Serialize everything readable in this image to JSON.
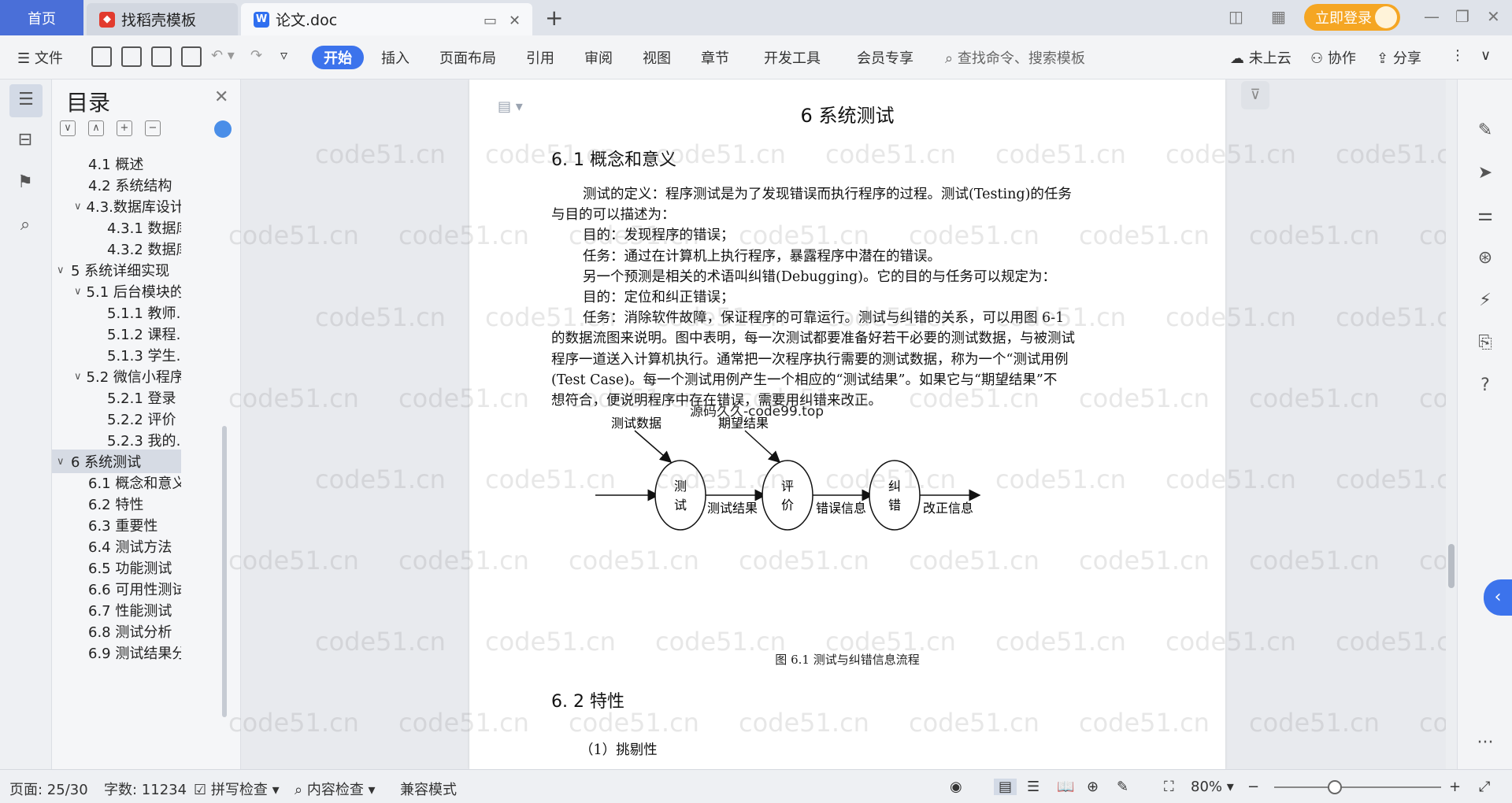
{
  "tabs": {
    "home": "首页",
    "template": "找稻壳模板",
    "doc": "论文.doc",
    "login": "立即登录"
  },
  "toolbar": {
    "file": "文件",
    "start": "开始",
    "insert": "插入",
    "layout": "页面布局",
    "reference": "引用",
    "review": "审阅",
    "view": "视图",
    "chapter": "章节",
    "devtools": "开发工具",
    "member": "会员专享",
    "search_placeholder": "查找命令、搜索模板",
    "cloud": "未上云",
    "collab": "协作",
    "share": "分享"
  },
  "outline": {
    "title": "目录",
    "items": [
      {
        "label": "4.1 概述",
        "level": 2,
        "chev": ""
      },
      {
        "label": "4.2 系统结构",
        "level": 2,
        "chev": ""
      },
      {
        "label": "4.3.数据库设计",
        "level": 2,
        "chev": "∨"
      },
      {
        "label": "4.3.1 数据库…",
        "level": 3,
        "chev": ""
      },
      {
        "label": "4.3.2 数据库…",
        "level": 3,
        "chev": ""
      },
      {
        "label": "5 系统详细实现",
        "level": 1,
        "chev": "∨"
      },
      {
        "label": "5.1  后台模块的…",
        "level": 2,
        "chev": "∨"
      },
      {
        "label": "5.1.1  教师…",
        "level": 3,
        "chev": ""
      },
      {
        "label": "5.1.2  课程…",
        "level": 3,
        "chev": ""
      },
      {
        "label": "5.1.3  学生…",
        "level": 3,
        "chev": ""
      },
      {
        "label": "5.2  微信小程序…",
        "level": 2,
        "chev": "∨"
      },
      {
        "label": "5.2.1  登录",
        "level": 3,
        "chev": ""
      },
      {
        "label": "5.2.2  评价",
        "level": 3,
        "chev": ""
      },
      {
        "label": "5.2.3  我的…",
        "level": 3,
        "chev": ""
      },
      {
        "label": "6 系统测试",
        "level": 1,
        "chev": "∨",
        "selected": true
      },
      {
        "label": "6.1 概念和意义",
        "level": 2,
        "chev": ""
      },
      {
        "label": "6.2 特性",
        "level": 2,
        "chev": ""
      },
      {
        "label": "6.3 重要性",
        "level": 2,
        "chev": ""
      },
      {
        "label": "6.4 测试方法",
        "level": 2,
        "chev": ""
      },
      {
        "label": "6.5  功能测试",
        "level": 2,
        "chev": ""
      },
      {
        "label": "6.6 可用性测试",
        "level": 2,
        "chev": ""
      },
      {
        "label": "6.7 性能测试",
        "level": 2,
        "chev": ""
      },
      {
        "label": "6.8 测试分析",
        "level": 2,
        "chev": ""
      },
      {
        "label": "6.9 测试结果分…",
        "level": 2,
        "chev": ""
      }
    ]
  },
  "document": {
    "chapter_title": "6 系统测试",
    "section1": "6. 1 概念和意义",
    "paragraphs": [
      "测试的定义：程序测试是为了发现错误而执行程序的过程。测试(Testing)的任务",
      "与目的可以描述为：",
      "目的：发现程序的错误；",
      "任务：通过在计算机上执行程序，暴露程序中潜在的错误。",
      "另一个预测是相关的术语叫纠错(Debugging)。它的目的与任务可以规定为：",
      "目的：定位和纠正错误；",
      "任务：消除软件故障，保证程序的可靠运行。测试与纠错的关系，可以用图 6-1",
      "的数据流图来说明。图中表明，每一次测试都要准备好若干必要的测试数据，与被测试",
      "程序一道送入计算机执行。通常把一次程序执行需要的测试数据，称为一个“测试用例",
      "(Test Case)。每一个测试用例产生一个相应的“测试结果”。如果它与“期望结果”不",
      "想符合，便说明程序中存在错误，需要用纠错来改正。"
    ],
    "overlay": "源码久久-code99.top",
    "figure": {
      "input1": "测试数据",
      "input2": "期望结果",
      "node1": "测\n试",
      "node1_a": "测",
      "node1_b": "试",
      "node2_a": "评",
      "node2_b": "价",
      "node3_a": "纠",
      "node3_b": "错",
      "edge1": "测试结果",
      "edge2": "错误信息",
      "edge3": "改正信息",
      "caption": "图 6.1 测试与纠错信息流程"
    },
    "section2": "6. 2 特性",
    "item1": "（1）挑剔性"
  },
  "watermark": "code51.cn",
  "status": {
    "page": "页面: 25/30",
    "words": "字数: 11234",
    "spell": "拼写检查",
    "content": "内容检查",
    "compat": "兼容模式",
    "zoom": "80%"
  },
  "colors": {
    "accent": "#3c73ec",
    "home_tab": "#4a6fd8",
    "login": "#f5a623"
  }
}
